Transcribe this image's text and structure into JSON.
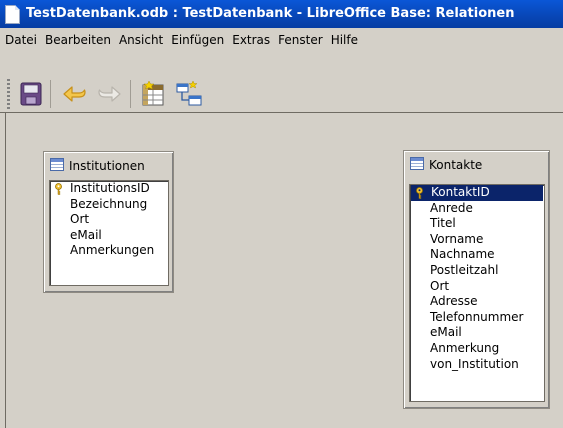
{
  "window": {
    "title": "TestDatenbank.odb : TestDatenbank - LibreOffice Base: Relationen"
  },
  "menu": [
    {
      "label": "Datei"
    },
    {
      "label": "Bearbeiten"
    },
    {
      "label": "Ansicht"
    },
    {
      "label": "Einfügen"
    },
    {
      "label": "Extras"
    },
    {
      "label": "Fenster"
    },
    {
      "label": "Hilfe"
    }
  ],
  "toolbar": {
    "buttons": [
      {
        "name": "save-icon"
      },
      {
        "name": "undo-icon"
      },
      {
        "name": "redo-icon"
      },
      {
        "name": "new-table-icon"
      },
      {
        "name": "new-relation-icon"
      }
    ]
  },
  "tables": [
    {
      "title": "Institutionen",
      "fields": [
        {
          "label": "InstitutionsID",
          "primary_key": true
        },
        {
          "label": "Bezeichnung"
        },
        {
          "label": "Ort"
        },
        {
          "label": "eMail"
        },
        {
          "label": "Anmerkungen"
        }
      ]
    },
    {
      "title": "Kontakte",
      "fields": [
        {
          "label": "KontaktID",
          "primary_key": true,
          "selected": true
        },
        {
          "label": "Anrede"
        },
        {
          "label": "Titel"
        },
        {
          "label": "Vorname"
        },
        {
          "label": "Nachname"
        },
        {
          "label": "Postleitzahl"
        },
        {
          "label": "Ort"
        },
        {
          "label": "Adresse"
        },
        {
          "label": "Telefonnummer"
        },
        {
          "label": "eMail"
        },
        {
          "label": "Anmerkung"
        },
        {
          "label": "von_Institution"
        }
      ]
    }
  ],
  "colors": {
    "titlebar": "#0a57d7",
    "selection": "#0b246a",
    "background": "#d4d0c8"
  }
}
